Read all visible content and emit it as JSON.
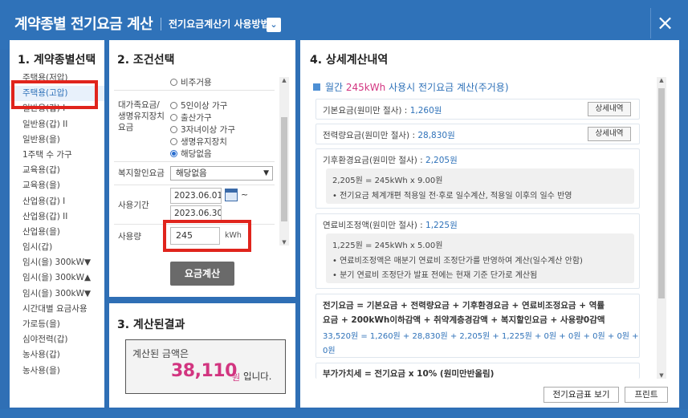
{
  "header": {
    "title": "계약종별 전기요금 계산",
    "help_link": "전기요금계산기 사용방법",
    "close_icon": "×"
  },
  "contract_panel": {
    "heading": "1. 계약종별선택",
    "items": [
      "주택용(저압)",
      "주택용(고압)",
      "일반용(갑) I",
      "일반용(갑) II",
      "일반용(을)",
      "1주택 수 가구",
      "교육용(갑)",
      "교육용(을)",
      "산업용(갑) I",
      "산업용(갑) II",
      "산업용(을)",
      "임시(갑)",
      "임시(을) 300kW▼",
      "임시(을) 300kW▲",
      "임시(을) 300kW▼",
      "시간대별 요금사용",
      "가로등(을)",
      "심야전력(갑)",
      "농사용(갑)",
      "농사용(을)"
    ]
  },
  "condition_panel": {
    "heading": "2. 조건선택",
    "radio_top": "비주거용",
    "family_label_1": "대가족요금/",
    "family_label_2": "생명유지장치",
    "family_label_3": "요금",
    "radios": [
      "5인이상 가구",
      "출산가구",
      "3자녀이상 가구",
      "생명유지장치",
      "해당없음"
    ],
    "welfare_label": "복지할인요금",
    "welfare_value": "해당없음",
    "period_label": "사용기간",
    "date_start": "2023.06.01",
    "date_end": "2023.06.30",
    "tilde": "~",
    "usage_label": "사용량",
    "usage_value": "245",
    "usage_unit": "kWh",
    "calc_button": "요금계산"
  },
  "result_panel": {
    "heading": "3. 계산된결과",
    "label": "계산된 금액은",
    "amount": "38,110",
    "unit": "원",
    "tail": "입니다."
  },
  "detail_panel": {
    "heading": "4. 상세계산내역",
    "sub_pre": "월간 ",
    "sub_hl": "245kWh",
    "sub_post": " 사용시 전기요금 계산(주거용)",
    "base_label": "기본요금(원미만 절사) : ",
    "base_value": "1,260원",
    "energy_label": "전력량요금(원미만 절사) : ",
    "energy_value": "28,830원",
    "detail_button": "상세내역",
    "climate_label": "기후환경요금(원미만 절사) : ",
    "climate_value": "2,205원",
    "climate_calc": "2,205원 = 245kWh x 9.00원",
    "climate_note": "• 전기요금 체계개편 적용일 전·후로 일수계산, 적용일 이후의 일수 반영",
    "fuel_label": "연료비조정액(원미만 절사) : ",
    "fuel_value": "1,225원",
    "fuel_calc": "1,225원 = 245kWh x 5.00원",
    "fuel_note1": "• 연료비조정액은 매분기 연료비 조정단가를 반영하여 계산(일수계산 안함)",
    "fuel_note2": "• 분기 연료비 조정단가 발표 전에는 현재 기준 단가로 계산됨",
    "formula_line1": "전기요금 = 기본요금 + 전력량요금 + 기후환경요금 + 연료비조정요금 + 역률",
    "formula_line2": "요금 + 200kWh이하감액 + 취약계층경감액 + 복지할인요금 + 사용량0감액",
    "formula_values1": "33,520원 = 1,260원 + 28,830원 + 2,205원 + 1,225원 + 0원 + 0원 + 0원 + 0원 +",
    "formula_values2": "0원",
    "vat_line": "부가가치세 = 전기요금 x 10% (원미만반올림)",
    "btn_table": "전기요금표 보기",
    "btn_print": "프린트"
  }
}
